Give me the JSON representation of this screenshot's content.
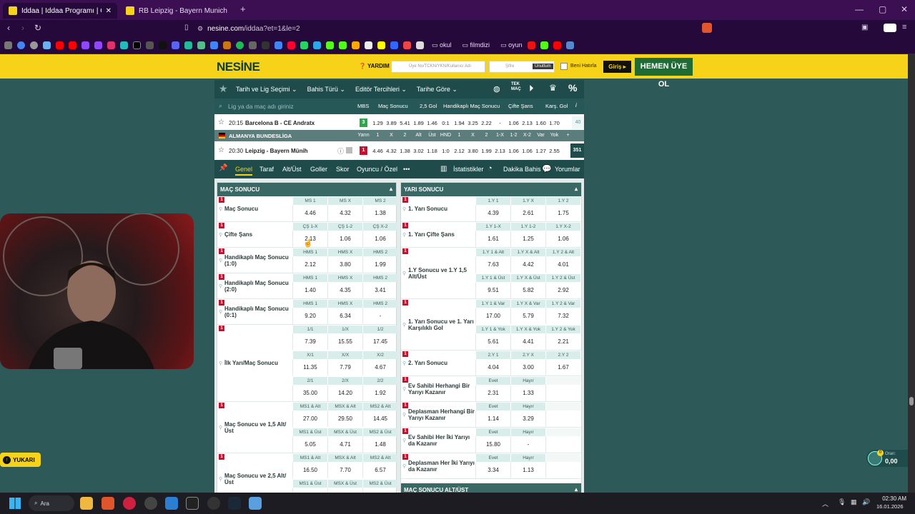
{
  "tabs": [
    {
      "label": "İddaa | İddaa Programı | Canlı İd...",
      "active": true
    },
    {
      "label": "RB Leipzig - Bayern Munich | İddaa M...",
      "active": false
    }
  ],
  "tab_close": "✕",
  "new_tab": "+",
  "window": {
    "min": "—",
    "max": "▢",
    "close": "✕"
  },
  "url": {
    "host": "nesine.com",
    "path": "/iddaa?et=1&le=2"
  },
  "bookmarks": [
    "okul",
    "filmdizi",
    "oyun"
  ],
  "site": {
    "logo": "NESİNE",
    "help": "YARDIM",
    "user_placeholder": "Üye No/TCKN/YKN/Kullanıcı Adı",
    "pass_placeholder": "Şifre",
    "forgot": "Unuttum",
    "remember": "Beni Hatırla",
    "login": "Giriş ▸",
    "register": "HEMEN ÜYE OL"
  },
  "filters": [
    "Tarih ve Lig Seçimi ⌄",
    "Bahis Türü ⌄",
    "Editör Tercihleri ⌄",
    "Tarihe Göre ⌄"
  ],
  "search": {
    "placeholder": "Lig ya da maç adı giriniz"
  },
  "colheads": {
    "mbs": "MBS",
    "mac": "Maç Sonucu",
    "gol": "2,5 Gol",
    "hnd": "Handikaplı Maç Sonucu",
    "cs": "Çifte Şans",
    "kg": "Karş. Gol",
    "info": "i"
  },
  "match1": {
    "time": "20:15",
    "name": "Barcelona B - CE Andratx",
    "mbs": "3",
    "odds": [
      "1.29",
      "3.89",
      "5.41",
      "1.89",
      "1.46",
      "0:1",
      "1.94",
      "3.25",
      "2.22",
      "-",
      "1.06",
      "2.13",
      "1.60",
      "1.70"
    ],
    "more": "40"
  },
  "league": {
    "name": "ALMANYA BUNDESLİGA",
    "labels": [
      "Yarın",
      "1",
      "X",
      "2",
      "Alt",
      "Üst",
      "HND",
      "1",
      "X",
      "2",
      "1-X",
      "1-2",
      "X-2",
      "Var",
      "Yok",
      "+"
    ]
  },
  "match2": {
    "time": "20:30",
    "name": "Leipzig - Bayern Münih",
    "mbs": "1",
    "odds": [
      "4.46",
      "4.32",
      "1.38",
      "3.02",
      "1.18",
      "1:0",
      "2.12",
      "3.80",
      "1.99",
      "2.13",
      "1.06",
      "1.06",
      "1.27",
      "2.55"
    ],
    "more": "351"
  },
  "subtabs": [
    "Genel",
    "Taraf",
    "Alt/Üst",
    "Goller",
    "Skor",
    "Oyuncu / Özel",
    "•••"
  ],
  "subtabs_right": [
    "İstatistikler",
    "Dakika Bahis",
    "Yorumlar"
  ],
  "left_panel": {
    "title": "MAÇ SONUCU",
    "markets": [
      {
        "label": "Maç Sonucu",
        "rows": [
          {
            "h": [
              "MS 1",
              "MS X",
              "MS 2"
            ],
            "v": [
              "4.46",
              "4.32",
              "1.38"
            ]
          }
        ]
      },
      {
        "label": "Çifte Şans",
        "rows": [
          {
            "h": [
              "ÇŞ 1-X",
              "ÇŞ 1-2",
              "ÇŞ X-2"
            ],
            "v": [
              "2.13",
              "1.06",
              "1.06"
            ]
          }
        ]
      },
      {
        "label": "Handikaplı Maç Sonucu (1:0)",
        "rows": [
          {
            "h": [
              "HMS 1",
              "HMS X",
              "HMS 2"
            ],
            "v": [
              "2.12",
              "3.80",
              "1.99"
            ]
          }
        ]
      },
      {
        "label": "Handikaplı Maç Sonucu (2:0)",
        "rows": [
          {
            "h": [
              "HMS 1",
              "HMS X",
              "HMS 2"
            ],
            "v": [
              "1.40",
              "4.35",
              "3.41"
            ]
          }
        ]
      },
      {
        "label": "Handikaplı Maç Sonucu (0:1)",
        "rows": [
          {
            "h": [
              "HMS 1",
              "HMS X",
              "HMS 2"
            ],
            "v": [
              "9.20",
              "6.34",
              "-"
            ]
          }
        ]
      },
      {
        "label": "İlk Yarı/Maç Sonucu",
        "rows": [
          {
            "h": [
              "1/1",
              "1/X",
              "1/2"
            ],
            "v": [
              "7.39",
              "15.55",
              "17.45"
            ]
          },
          {
            "h": [
              "X/1",
              "X/X",
              "X/2"
            ],
            "v": [
              "11.35",
              "7.79",
              "4.67"
            ]
          },
          {
            "h": [
              "2/1",
              "2/X",
              "2/2"
            ],
            "v": [
              "35.00",
              "14.20",
              "1.92"
            ]
          }
        ]
      },
      {
        "label": "Maç Sonucu ve 1,5 Alt/ Üst",
        "rows": [
          {
            "h": [
              "MS1 & Alt",
              "MSX & Alt",
              "MS2 & Alt"
            ],
            "v": [
              "27.00",
              "29.50",
              "14.45"
            ]
          },
          {
            "h": [
              "MS1 & Üst",
              "MSX & Üst",
              "MS2 & Üst"
            ],
            "v": [
              "5.05",
              "4.71",
              "1.48"
            ]
          }
        ]
      },
      {
        "label": "Maç Sonucu ve 2,5 Alt/ Üst",
        "rows": [
          {
            "h": [
              "MS1 & Alt",
              "MSX & Alt",
              "MS2 & Alt"
            ],
            "v": [
              "16.50",
              "7.70",
              "6.57"
            ]
          },
          {
            "h": [
              "MS1 & Üst",
              "MSX & Üst",
              "MS2 & Üst"
            ],
            "v": [
              "",
              "",
              ""
            ]
          }
        ]
      }
    ]
  },
  "right_panel": {
    "title": "YARI SONUCU",
    "markets": [
      {
        "label": "1. Yarı Sonucu",
        "rows": [
          {
            "h": [
              "1.Y 1",
              "1.Y X",
              "1.Y 2"
            ],
            "v": [
              "4.39",
              "2.61",
              "1.75"
            ]
          }
        ]
      },
      {
        "label": "1. Yarı Çifte Şans",
        "rows": [
          {
            "h": [
              "1.Y 1-X",
              "1.Y 1-2",
              "1.Y X-2"
            ],
            "v": [
              "1.61",
              "1.25",
              "1.06"
            ]
          }
        ]
      },
      {
        "label": "1.Y Sonucu ve 1.Y 1,5 Alt/Üst",
        "rows": [
          {
            "h": [
              "1.Y 1 & Alt",
              "1.Y X & Alt",
              "1.Y 2 & Alt"
            ],
            "v": [
              "7.63",
              "4.42",
              "4.01"
            ]
          },
          {
            "h": [
              "1.Y 1 & Üst",
              "1.Y X & Üst",
              "1.Y 2 & Üst"
            ],
            "v": [
              "9.51",
              "5.82",
              "2.92"
            ]
          }
        ]
      },
      {
        "label": "1. Yarı Sonucu ve 1. Yarı Karşılıklı Gol",
        "rows": [
          {
            "h": [
              "1.Y 1 & Var",
              "1.Y X & Var",
              "1.Y 2 & Var"
            ],
            "v": [
              "17.00",
              "5.79",
              "7.32"
            ]
          },
          {
            "h": [
              "1.Y 1 & Yok",
              "1.Y X & Yok",
              "1.Y 2 & Yok"
            ],
            "v": [
              "5.61",
              "4.41",
              "2.21"
            ]
          }
        ]
      },
      {
        "label": "2. Yarı Sonucu",
        "rows": [
          {
            "h": [
              "2.Y 1",
              "2.Y X",
              "2.Y 2"
            ],
            "v": [
              "4.04",
              "3.00",
              "1.67"
            ]
          }
        ]
      },
      {
        "label": "Ev Sahibi Herhangi Bir Yarıyı Kazanır",
        "rows": [
          {
            "h": [
              "Evet",
              "Hayır",
              ""
            ],
            "v": [
              "2.31",
              "1.33",
              ""
            ]
          }
        ]
      },
      {
        "label": "Deplasman Herhangi Bir Yarıyı Kazanır",
        "rows": [
          {
            "h": [
              "Evet",
              "Hayır",
              ""
            ],
            "v": [
              "1.14",
              "3.29",
              ""
            ]
          }
        ]
      },
      {
        "label": "Ev Sahibi Her İki Yarıyı da Kazanır",
        "rows": [
          {
            "h": [
              "Evet",
              "Hayır",
              ""
            ],
            "v": [
              "15.80",
              "-",
              ""
            ]
          }
        ]
      },
      {
        "label": "Deplasman Her İki Yarıyı da Kazanır",
        "rows": [
          {
            "h": [
              "Evet",
              "Hayır",
              ""
            ],
            "v": [
              "3.34",
              "1.13",
              ""
            ]
          }
        ]
      }
    ],
    "next_title": "MAÇ SONUCU ALT/ÜST"
  },
  "yukari": "YUKARI",
  "oran": {
    "label": "Oran:",
    "value": "0,00",
    "count": "0"
  },
  "taskbar": {
    "search": "Ara",
    "time": "02:30 AM",
    "date": "16.01.2026"
  }
}
